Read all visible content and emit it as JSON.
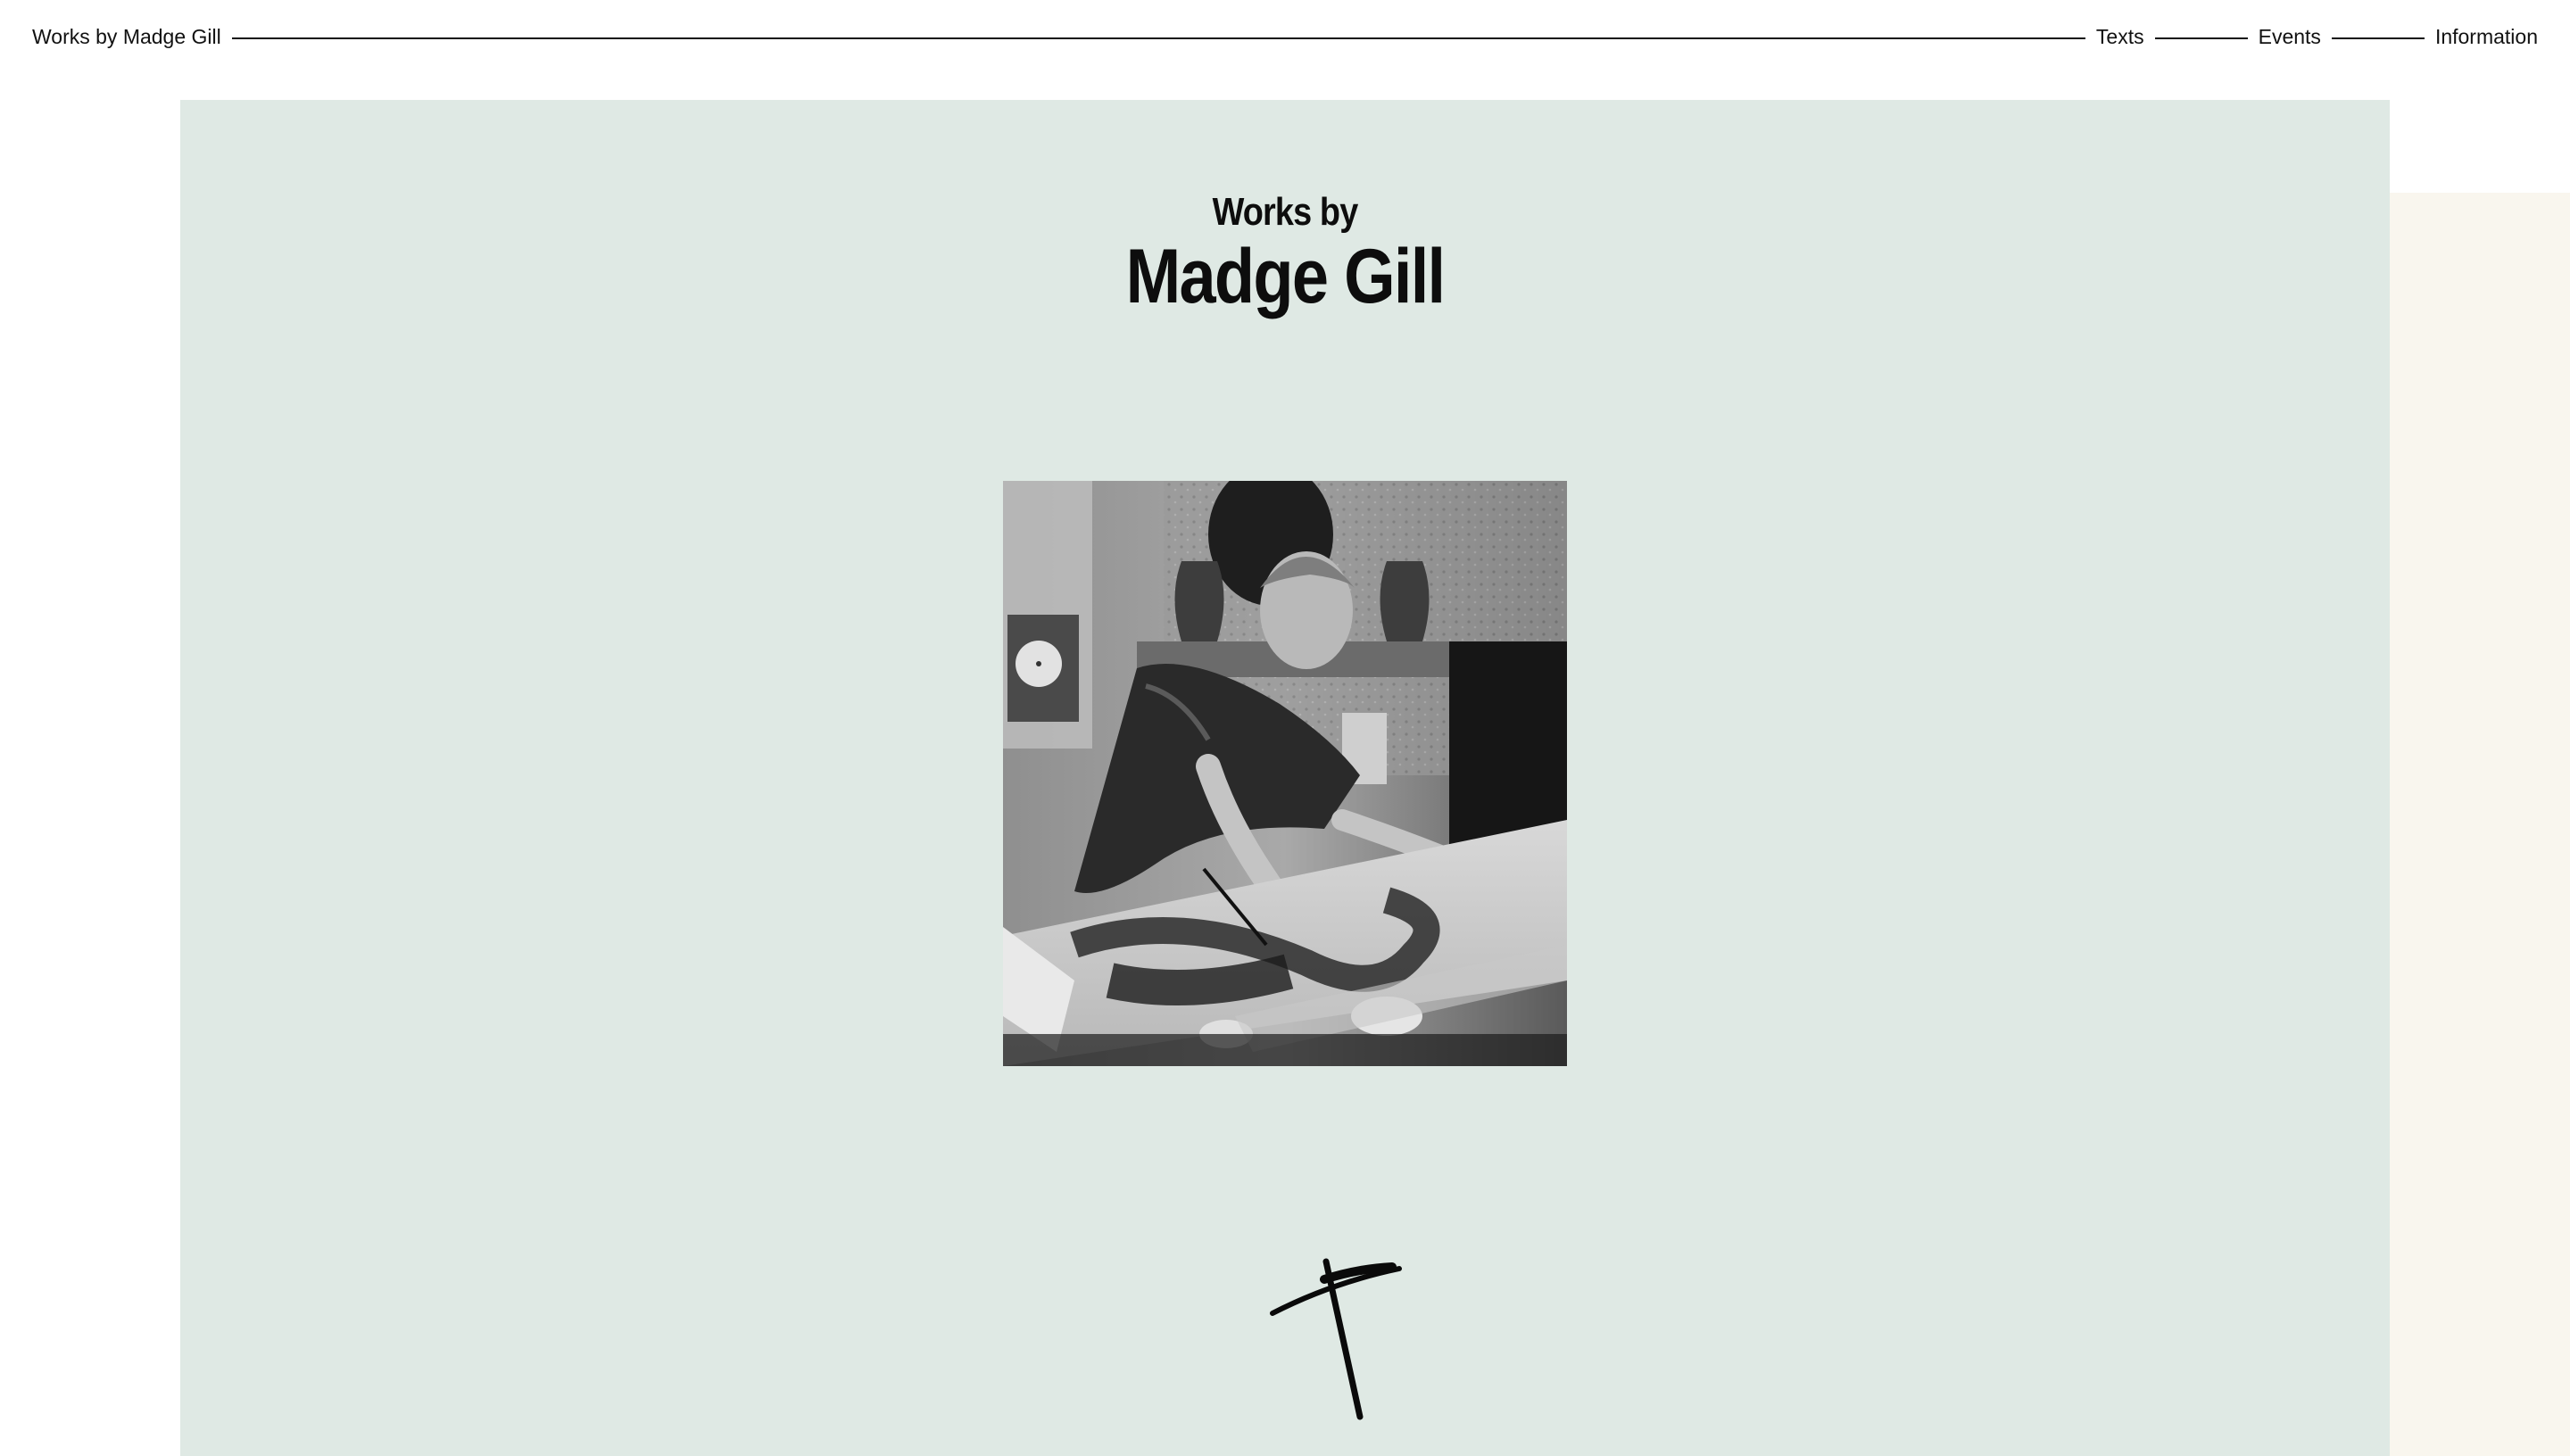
{
  "nav": {
    "home_label": "Works by Madge Gill",
    "links": [
      {
        "label": "Texts"
      },
      {
        "label": "Events"
      },
      {
        "label": "Information"
      }
    ]
  },
  "hero": {
    "kicker": "Works by",
    "title": "Madge Gill",
    "photo_icon": "photo-of-artist-drawing",
    "mark_icon": "cross-icon"
  },
  "colors": {
    "card_background": "#dfe9e4",
    "side_panel_background": "#f9f6ee",
    "text": "#111111"
  }
}
